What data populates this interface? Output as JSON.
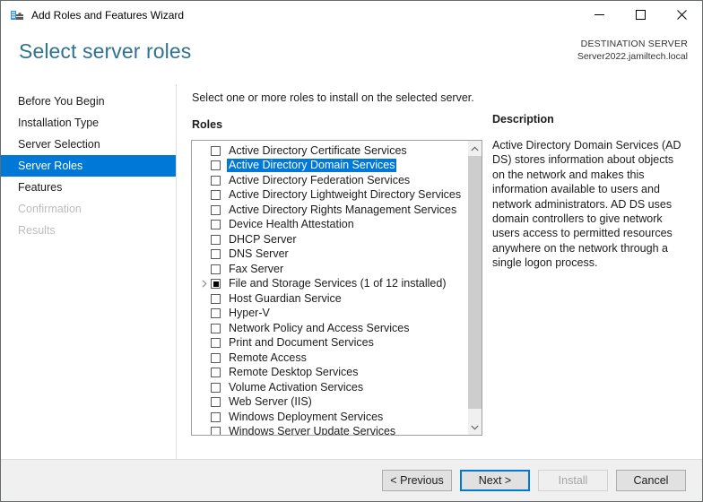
{
  "window": {
    "title": "Add Roles and Features Wizard",
    "icon": "roles-wizard-icon",
    "minimize_label": "Minimize",
    "maximize_label": "Maximize",
    "close_label": "Close"
  },
  "header": {
    "page_title": "Select server roles",
    "destination_label": "DESTINATION SERVER",
    "destination_server": "Server2022.jamiltech.local"
  },
  "sidebar": {
    "items": [
      {
        "label": "Before You Begin",
        "state": "normal"
      },
      {
        "label": "Installation Type",
        "state": "normal"
      },
      {
        "label": "Server Selection",
        "state": "normal"
      },
      {
        "label": "Server Roles",
        "state": "selected"
      },
      {
        "label": "Features",
        "state": "normal"
      },
      {
        "label": "Confirmation",
        "state": "disabled"
      },
      {
        "label": "Results",
        "state": "disabled"
      }
    ]
  },
  "content": {
    "instruction": "Select one or more roles to install on the selected server.",
    "roles_label": "Roles",
    "scroll_up_icon": "chevron-up-icon",
    "scroll_down_icon": "chevron-down-icon",
    "roles": [
      {
        "label": "Active Directory Certificate Services",
        "checked": "unchecked",
        "selected": false,
        "expandable": false
      },
      {
        "label": "Active Directory Domain Services",
        "checked": "unchecked",
        "selected": true,
        "expandable": false
      },
      {
        "label": "Active Directory Federation Services",
        "checked": "unchecked",
        "selected": false,
        "expandable": false
      },
      {
        "label": "Active Directory Lightweight Directory Services",
        "checked": "unchecked",
        "selected": false,
        "expandable": false
      },
      {
        "label": "Active Directory Rights Management Services",
        "checked": "unchecked",
        "selected": false,
        "expandable": false
      },
      {
        "label": "Device Health Attestation",
        "checked": "unchecked",
        "selected": false,
        "expandable": false
      },
      {
        "label": "DHCP Server",
        "checked": "unchecked",
        "selected": false,
        "expandable": false
      },
      {
        "label": "DNS Server",
        "checked": "unchecked",
        "selected": false,
        "expandable": false
      },
      {
        "label": "Fax Server",
        "checked": "unchecked",
        "selected": false,
        "expandable": false
      },
      {
        "label": "File and Storage Services (1 of 12 installed)",
        "checked": "partial",
        "selected": false,
        "expandable": true
      },
      {
        "label": "Host Guardian Service",
        "checked": "unchecked",
        "selected": false,
        "expandable": false
      },
      {
        "label": "Hyper-V",
        "checked": "unchecked",
        "selected": false,
        "expandable": false
      },
      {
        "label": "Network Policy and Access Services",
        "checked": "unchecked",
        "selected": false,
        "expandable": false
      },
      {
        "label": "Print and Document Services",
        "checked": "unchecked",
        "selected": false,
        "expandable": false
      },
      {
        "label": "Remote Access",
        "checked": "unchecked",
        "selected": false,
        "expandable": false
      },
      {
        "label": "Remote Desktop Services",
        "checked": "unchecked",
        "selected": false,
        "expandable": false
      },
      {
        "label": "Volume Activation Services",
        "checked": "unchecked",
        "selected": false,
        "expandable": false
      },
      {
        "label": "Web Server (IIS)",
        "checked": "unchecked",
        "selected": false,
        "expandable": false
      },
      {
        "label": "Windows Deployment Services",
        "checked": "unchecked",
        "selected": false,
        "expandable": false
      },
      {
        "label": "Windows Server Update Services",
        "checked": "unchecked",
        "selected": false,
        "expandable": false
      }
    ]
  },
  "description": {
    "title": "Description",
    "text": "Active Directory Domain Services (AD DS) stores information about objects on the network and makes this information available to users and network administrators. AD DS uses domain controllers to give network users access to permitted resources anywhere on the network through a single logon process."
  },
  "footer": {
    "previous_label": "< Previous",
    "next_label": "Next >",
    "install_label": "Install",
    "cancel_label": "Cancel"
  },
  "colors": {
    "accent": "#0078d7",
    "title_text": "#2f7391",
    "footer_bg": "#f0f0f0",
    "scroll_thumb": "#cdcdcd"
  }
}
